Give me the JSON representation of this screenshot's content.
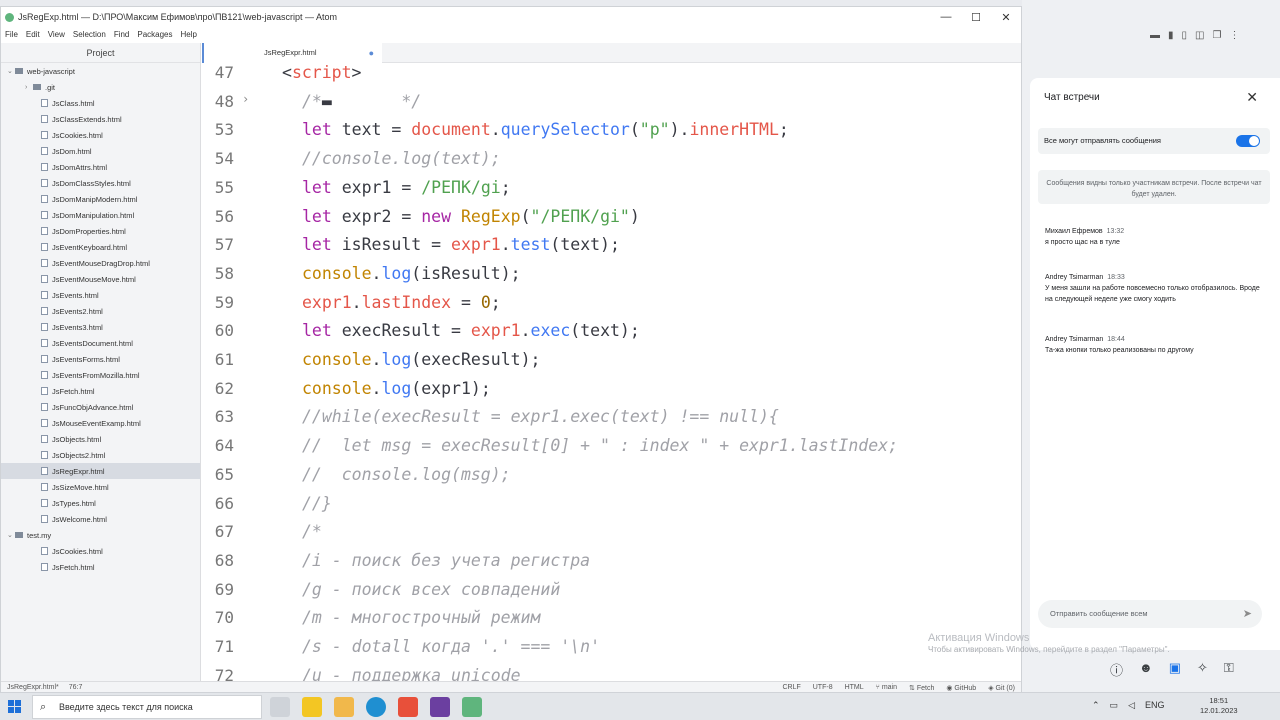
{
  "window": {
    "title": "JsRegExp.html — D:\\ПРО\\Максим Ефимов\\про\\ПВ121\\web-javascript — Atom"
  },
  "menu": [
    "File",
    "Edit",
    "View",
    "Selection",
    "Find",
    "Packages",
    "Help"
  ],
  "tree": {
    "title": "Project",
    "root": "web-javascript",
    "items": [
      {
        "label": ".git",
        "type": "folder"
      },
      {
        "label": "JsClass.html",
        "type": "file"
      },
      {
        "label": "JsClassExtends.html",
        "type": "file"
      },
      {
        "label": "JsCookies.html",
        "type": "file"
      },
      {
        "label": "JsDom.html",
        "type": "file"
      },
      {
        "label": "JsDomAttrs.html",
        "type": "file"
      },
      {
        "label": "JsDomClassStyles.html",
        "type": "file"
      },
      {
        "label": "JsDomManipModern.html",
        "type": "file"
      },
      {
        "label": "JsDomManipulation.html",
        "type": "file"
      },
      {
        "label": "JsDomProperties.html",
        "type": "file"
      },
      {
        "label": "JsEventKeyboard.html",
        "type": "file"
      },
      {
        "label": "JsEventMouseDragDrop.html",
        "type": "file"
      },
      {
        "label": "JsEventMouseMove.html",
        "type": "file"
      },
      {
        "label": "JsEvents.html",
        "type": "file"
      },
      {
        "label": "JsEvents2.html",
        "type": "file"
      },
      {
        "label": "JsEvents3.html",
        "type": "file"
      },
      {
        "label": "JsEventsDocument.html",
        "type": "file"
      },
      {
        "label": "JsEventsForms.html",
        "type": "file"
      },
      {
        "label": "JsEventsFromMozilla.html",
        "type": "file"
      },
      {
        "label": "JsFetch.html",
        "type": "file"
      },
      {
        "label": "JsFuncObjAdvance.html",
        "type": "file"
      },
      {
        "label": "JsMouseEventExamp.html",
        "type": "file"
      },
      {
        "label": "JsObjects.html",
        "type": "file"
      },
      {
        "label": "JsObjects2.html",
        "type": "file"
      },
      {
        "label": "JsRegExpr.html",
        "type": "file",
        "selected": true
      },
      {
        "label": "JsSizeMove.html",
        "type": "file"
      },
      {
        "label": "JsTypes.html",
        "type": "file"
      },
      {
        "label": "JsWelcome.html",
        "type": "file"
      }
    ],
    "root2": "test.my",
    "items2": [
      {
        "label": "JsCookies.html",
        "type": "file"
      },
      {
        "label": "JsFetch.html",
        "type": "file"
      }
    ]
  },
  "tab": {
    "label": "JsRegExpr.html",
    "modified": "●"
  },
  "code_lines": [
    {
      "n": "47",
      "indent": 80,
      "tokens": [
        [
          "p",
          "<"
        ],
        [
          "t",
          "script"
        ],
        [
          "p",
          ">"
        ]
      ]
    },
    {
      "n": "48",
      "indent": 100,
      "fold": true,
      "tokens": [
        [
          "c",
          "/*"
        ],
        [
          "p",
          "▬"
        ],
        [
          "c",
          "       */"
        ]
      ]
    },
    {
      "n": "53",
      "indent": 100,
      "tokens": [
        [
          "k",
          "let "
        ],
        [
          "v",
          "text "
        ],
        [
          "p",
          "= "
        ],
        [
          "t",
          "document"
        ],
        [
          "p",
          "."
        ],
        [
          "f",
          "querySelector"
        ],
        [
          "p",
          "("
        ],
        [
          "s",
          "\"p\""
        ],
        [
          "p",
          ")."
        ],
        [
          "t",
          "innerHTML"
        ],
        [
          "p",
          ";"
        ]
      ]
    },
    {
      "n": "54",
      "indent": 100,
      "tokens": [
        [
          "c",
          "//console.log(text);"
        ]
      ]
    },
    {
      "n": "55",
      "indent": 100,
      "tokens": [
        [
          "k",
          "let "
        ],
        [
          "v",
          "expr1 "
        ],
        [
          "p",
          "= "
        ],
        [
          "s",
          "/РЕПК/gi"
        ],
        [
          "p",
          ";"
        ]
      ]
    },
    {
      "n": "56",
      "indent": 100,
      "tokens": [
        [
          "k",
          "let "
        ],
        [
          "v",
          "expr2 "
        ],
        [
          "p",
          "= "
        ],
        [
          "k",
          "new "
        ],
        [
          "cl",
          "RegExp"
        ],
        [
          "p",
          "("
        ],
        [
          "s",
          "\"/РЕПК/gi\""
        ],
        [
          "p",
          ")"
        ]
      ]
    },
    {
      "n": "57",
      "indent": 100,
      "tokens": [
        [
          "k",
          "let "
        ],
        [
          "v",
          "isResult "
        ],
        [
          "p",
          "= "
        ],
        [
          "t",
          "expr1"
        ],
        [
          "p",
          "."
        ],
        [
          "f",
          "test"
        ],
        [
          "p",
          "(text);"
        ]
      ]
    },
    {
      "n": "58",
      "indent": 100,
      "tokens": [
        [
          "cl",
          "console"
        ],
        [
          "p",
          "."
        ],
        [
          "f",
          "log"
        ],
        [
          "p",
          "(isResult);"
        ]
      ]
    },
    {
      "n": "59",
      "indent": 100,
      "tokens": [
        [
          "t",
          "expr1"
        ],
        [
          "p",
          "."
        ],
        [
          "t",
          "lastIndex "
        ],
        [
          "p",
          "= "
        ],
        [
          "n",
          "0"
        ],
        [
          "p",
          ";"
        ]
      ]
    },
    {
      "n": "60",
      "indent": 100,
      "tokens": [
        [
          "k",
          "let "
        ],
        [
          "v",
          "execResult "
        ],
        [
          "p",
          "= "
        ],
        [
          "t",
          "expr1"
        ],
        [
          "p",
          "."
        ],
        [
          "f",
          "exec"
        ],
        [
          "p",
          "(text);"
        ]
      ]
    },
    {
      "n": "61",
      "indent": 100,
      "tokens": [
        [
          "cl",
          "console"
        ],
        [
          "p",
          "."
        ],
        [
          "f",
          "log"
        ],
        [
          "p",
          "(execResult);"
        ]
      ]
    },
    {
      "n": "62",
      "indent": 100,
      "tokens": [
        [
          "cl",
          "console"
        ],
        [
          "p",
          "."
        ],
        [
          "f",
          "log"
        ],
        [
          "p",
          "(expr1);"
        ]
      ]
    },
    {
      "n": "63",
      "indent": 100,
      "tokens": [
        [
          "c",
          "//while(execResult = expr1.exec(text) !== null){"
        ]
      ]
    },
    {
      "n": "64",
      "indent": 100,
      "tokens": [
        [
          "c",
          "//  let msg = execResult[0] + \" : index \" + expr1.lastIndex;"
        ]
      ]
    },
    {
      "n": "65",
      "indent": 100,
      "tokens": [
        [
          "c",
          "//  console.log(msg);"
        ]
      ]
    },
    {
      "n": "66",
      "indent": 100,
      "tokens": [
        [
          "c",
          "//}"
        ]
      ]
    },
    {
      "n": "67",
      "indent": 100,
      "tokens": [
        [
          "c",
          "/*"
        ]
      ]
    },
    {
      "n": "68",
      "indent": 100,
      "tokens": [
        [
          "c",
          "/i - поиск без учета регистра"
        ]
      ]
    },
    {
      "n": "69",
      "indent": 100,
      "tokens": [
        [
          "c",
          "/g - поиск всех совпадений"
        ]
      ]
    },
    {
      "n": "70",
      "indent": 100,
      "tokens": [
        [
          "c",
          "/m - многострочный режим"
        ]
      ]
    },
    {
      "n": "71",
      "indent": 100,
      "tokens": [
        [
          "c",
          "/s - dotall когда '.' === '\\n'"
        ]
      ]
    },
    {
      "n": "72",
      "indent": 100,
      "tokens": [
        [
          "c",
          "/u - поддержка unicode"
        ]
      ]
    }
  ],
  "statusbar": {
    "file": "JsRegExpr.html*",
    "cursor": "76:7",
    "right": [
      "CRLF",
      "UTF-8",
      "HTML",
      "main",
      "Fetch",
      "GitHub",
      "Git (0)"
    ]
  },
  "chat": {
    "title": "Чат встречи",
    "toggle_label": "Все могут отправлять сообщения",
    "notice": "Сообщения видны только участникам встречи. После встречи чат будет удален.",
    "messages": [
      {
        "author": "Михаил Ефремов",
        "time": "13:32",
        "text": "я просто щас на в туле"
      },
      {
        "author": "Andrey Tsimarman",
        "time": "18:33",
        "text": "У меня зашли на работе повсемесно только отобразилось. Вроде на следующей неделе уже смогу ходить"
      },
      {
        "author": "Andrey Tsimarman",
        "time": "18:44",
        "text": "Та-жа кнопки только реализованы по другому"
      }
    ],
    "input_placeholder": "Отправить сообщение всем"
  },
  "watermark": {
    "title": "Активация Windows",
    "text": "Чтобы активировать Windows, перейдите в раздел \"Параметры\"."
  },
  "taskbar": {
    "search_placeholder": "Введите здесь текст для поиска",
    "lang": "ENG",
    "time": "18:51",
    "date": "12.01.2023"
  }
}
